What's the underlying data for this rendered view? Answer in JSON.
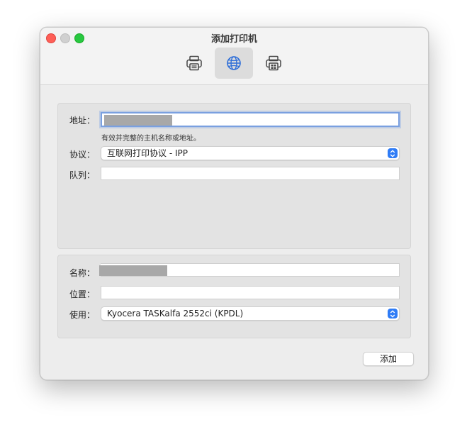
{
  "window": {
    "title": "添加打印机"
  },
  "toolbar": {
    "items": [
      {
        "icon": "printer-icon",
        "selected": false
      },
      {
        "icon": "globe-icon",
        "selected": true
      },
      {
        "icon": "fax-printer-icon",
        "selected": false
      }
    ]
  },
  "connection": {
    "address_label": "地址：",
    "address_value": "",
    "address_hint": "有效并完整的主机名称或地址。",
    "protocol_label": "协议：",
    "protocol_value": "互联网打印协议 - IPP",
    "queue_label": "队列：",
    "queue_value": ""
  },
  "details": {
    "name_label": "名称：",
    "name_value": "",
    "location_label": "位置：",
    "location_value": "",
    "use_label": "使用：",
    "use_value": "Kyocera TASKalfa 2552ci (KPDL)"
  },
  "footer": {
    "add_label": "添加"
  },
  "colors": {
    "accent": "#2f7cf6",
    "focus_ring": "#7aa0e0"
  }
}
